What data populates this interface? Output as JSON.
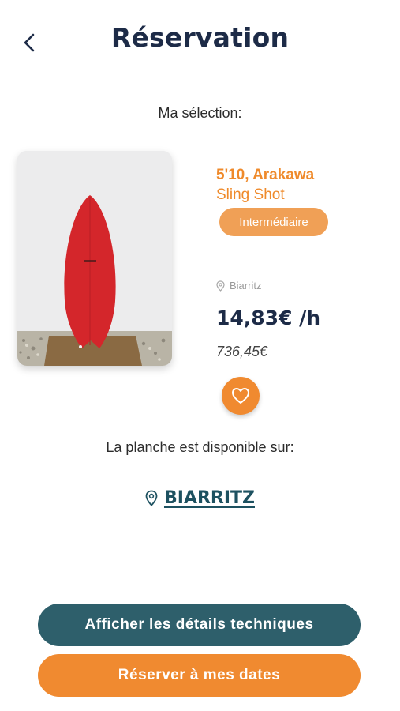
{
  "header": {
    "title": "Réservation",
    "back_icon": "chevron-left-icon"
  },
  "selection": {
    "label": "Ma sélection:"
  },
  "board": {
    "name": "5'10, Arakawa",
    "model": "Sling Shot",
    "level": "Intermédiaire",
    "location": "Biarritz",
    "price_per_hour": "14,83€ /h",
    "total_price": "736,45€",
    "board_color": "#d4262b"
  },
  "availability": {
    "label": "La planche est disponible sur:",
    "spot": "BIARRITZ"
  },
  "actions": {
    "details_label": "Afficher les détails techniques",
    "book_label": "Réserver à mes dates"
  },
  "colors": {
    "accent_orange": "#f08a30",
    "teal": "#2e5f6b",
    "navy": "#1d2b47"
  }
}
